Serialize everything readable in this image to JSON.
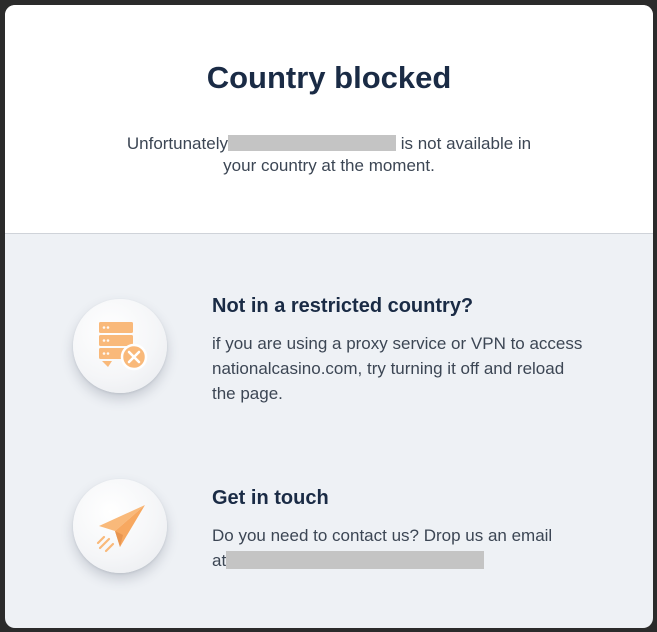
{
  "header": {
    "title": "Country blocked",
    "message_before": "Unfortunately",
    "message_after": "is not available in",
    "message_line2": "your country at the moment."
  },
  "sections": [
    {
      "icon": "server-blocked-icon",
      "heading": "Not in a restricted country?",
      "body": "if you are using a proxy service or VPN to access nationalcasino.com, try turning it off and reload the page."
    },
    {
      "icon": "paper-plane-icon",
      "heading": "Get in touch",
      "body_line1": "Do you need to contact us? Drop us an email",
      "body_prefix": "at"
    }
  ],
  "colors": {
    "accent": "#f9b97a",
    "title": "#1a2b45",
    "text": "#3c4654",
    "panel": "#eef1f5",
    "redaction": "#c4c4c4"
  }
}
